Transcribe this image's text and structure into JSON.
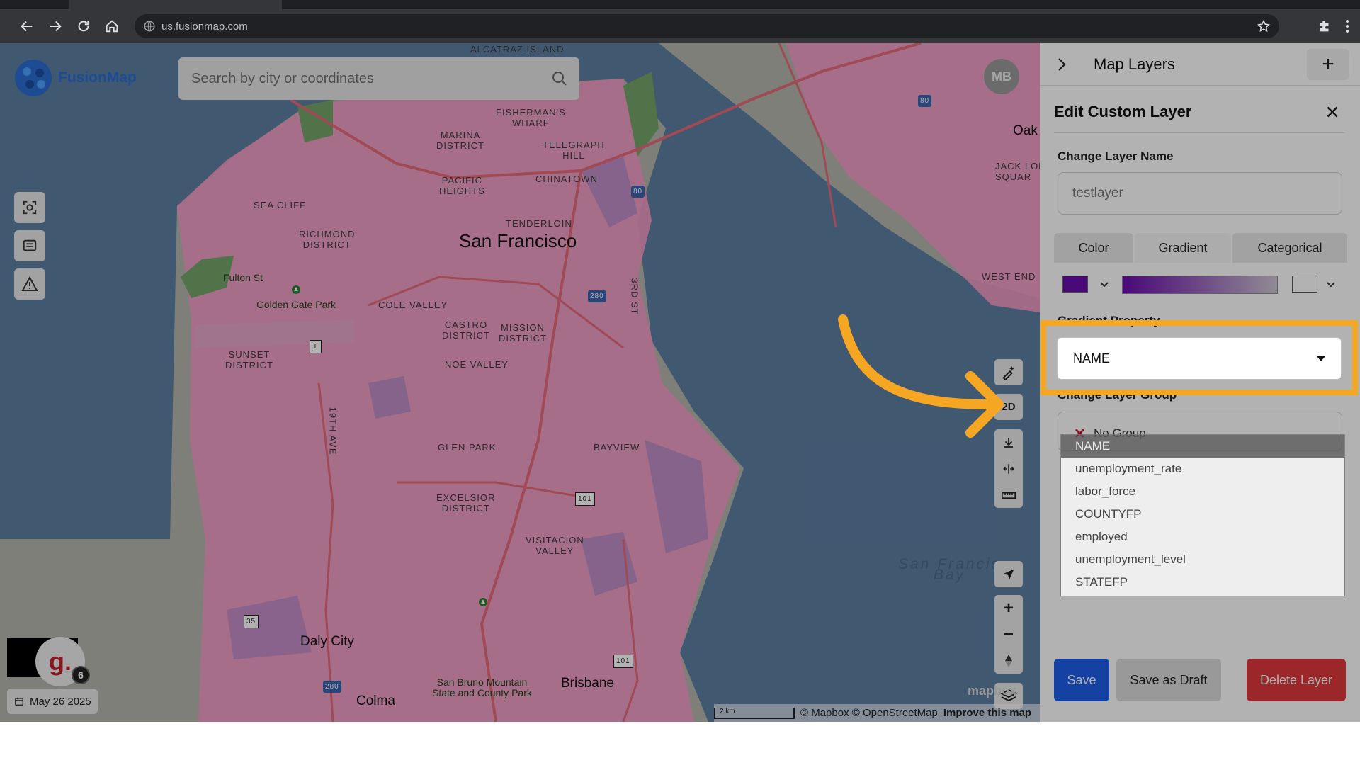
{
  "browser": {
    "url": "us.fusionmap.com"
  },
  "app": {
    "logo_text": "FusionMap",
    "search_placeholder": "Search by city or coordinates",
    "user_initials": "MB",
    "date": "May 26 2025",
    "recorder_letter": "g.",
    "recorder_badge": "6"
  },
  "map": {
    "labels": {
      "alcatraz": "Alcatraz Island",
      "fishermans_wharf": "FISHERMAN'S\nWHARF",
      "marina": "MARINA\nDISTRICT",
      "telegraph_hill": "TELEGRAPH\nHILL",
      "pacific_heights": "PACIFIC\nHEIGHTS",
      "chinatown": "CHINATOWN",
      "tenderloin": "TENDERLOIN",
      "sea_cliff": "SEA CLIFF",
      "richmond": "RICHMOND\nDISTRICT",
      "city": "San Francisco",
      "fulton": "Fulton St",
      "golden_gate_park": "Golden Gate Park",
      "cole_valley": "COLE VALLEY",
      "castro": "CASTRO\nDISTRICT",
      "mission": "MISSION\nDISTRICT",
      "sunset": "SUNSET\nDISTRICT",
      "noe_valley": "NOE VALLEY",
      "glen_park": "GLEN PARK",
      "bayview": "BAYVIEW",
      "excelsior": "EXCELSIOR\nDISTRICT",
      "visitacion": "VISITACION\nVALLEY",
      "daly_city": "Daly City",
      "san_bruno": "San Bruno Mountain\nState and County Park",
      "brisbane": "Brisbane",
      "colma": "Colma",
      "oak": "Oak",
      "jack_london": "JACK LON\nSQUAR",
      "west_end": "WEST END",
      "bay": "San Francis\nBay",
      "third_st": "3rd St",
      "nineteenth_ave": "19th Ave"
    },
    "shields": {
      "i80_a": "80",
      "i80_b": "80",
      "i280_a": "280",
      "i280_b": "280",
      "r1": "1",
      "r101_a": "101",
      "r101_b": "101",
      "r35": "35"
    },
    "controls": {
      "mode_2d": "2D"
    },
    "attribution": {
      "scale": "2 km",
      "text": "© Mapbox © OpenStreetMap",
      "improve": "Improve this map",
      "mapbox_logo": "mapbox"
    }
  },
  "panel": {
    "title": "Map Layers",
    "edit_title": "Edit Custom Layer",
    "change_name_label": "Change Layer Name",
    "layer_name_value": "testlayer",
    "tabs": [
      "Color",
      "Gradient",
      "Categorical"
    ],
    "active_tab": "Gradient",
    "gradient_start_color": "#6a0dad",
    "gradient_property_label": "Gradient Property",
    "gradient_property_value": "NAME",
    "change_group_label": "Change Layer Group",
    "group_value": "No Group",
    "dropdown_options": [
      "NAME",
      "unemployment_rate",
      "labor_force",
      "COUNTYFP",
      "employed",
      "unemployment_level",
      "STATEFP"
    ],
    "buttons": {
      "save": "Save",
      "draft": "Save as Draft",
      "delete": "Delete Layer"
    }
  },
  "colors": {
    "highlight": "#f5a623",
    "save_btn": "#1d5ee8",
    "delete_btn": "#e0383e",
    "layer_fill": "#f39cc6"
  }
}
